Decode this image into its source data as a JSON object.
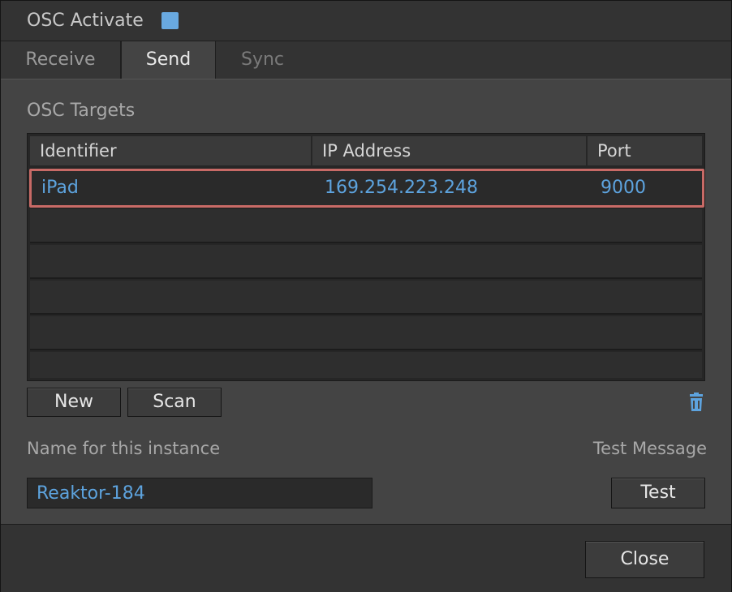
{
  "titlebar": {
    "title": "OSC Activate",
    "activate_checked": true
  },
  "tabs": [
    {
      "label": "Receive",
      "active": false
    },
    {
      "label": "Send",
      "active": true
    },
    {
      "label": "Sync",
      "active": false
    }
  ],
  "targets": {
    "section_title": "OSC Targets",
    "columns": [
      "Identifier",
      "IP Address",
      "Port"
    ],
    "rows": [
      {
        "identifier": "iPad",
        "ip": "169.254.223.248",
        "port": "9000",
        "selected": true
      },
      {
        "identifier": "",
        "ip": "",
        "port": ""
      },
      {
        "identifier": "",
        "ip": "",
        "port": ""
      },
      {
        "identifier": "",
        "ip": "",
        "port": ""
      },
      {
        "identifier": "",
        "ip": "",
        "port": ""
      }
    ]
  },
  "buttons": {
    "new": "New",
    "scan": "Scan",
    "test": "Test",
    "close": "Close"
  },
  "instance": {
    "label": "Name for this instance",
    "value": "Reaktor-184"
  },
  "test_message": {
    "label": "Test Message"
  },
  "colors": {
    "accent": "#5da3de",
    "selection_border": "#c86a66"
  },
  "icons": {
    "delete": "trash-icon"
  }
}
